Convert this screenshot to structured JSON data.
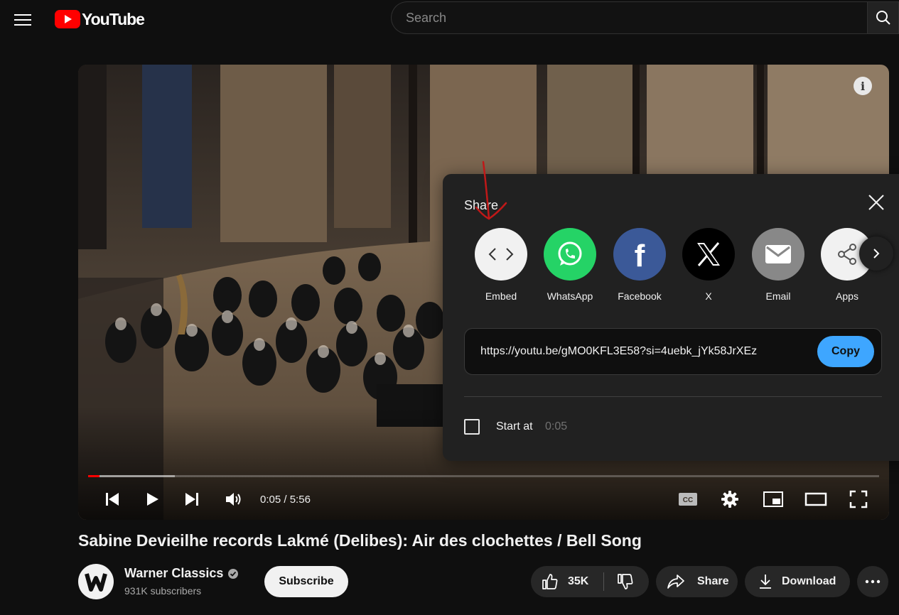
{
  "header": {
    "logo_text": "YouTube",
    "search_placeholder": "Search"
  },
  "player": {
    "time_current": "0:05",
    "time_separator": " / ",
    "time_total": "5:56",
    "progress_played_fraction": 0.0141,
    "progress_buffered_fraction": 0.11
  },
  "share_dialog": {
    "title": "Share",
    "targets": [
      {
        "label": "Embed",
        "icon": "embed-icon",
        "color": "#f1f1f1"
      },
      {
        "label": "WhatsApp",
        "icon": "whatsapp-icon",
        "color": "#25d366"
      },
      {
        "label": "Facebook",
        "icon": "facebook-icon",
        "color": "#3b5998"
      },
      {
        "label": "X",
        "icon": "x-icon",
        "color": "#000000"
      },
      {
        "label": "Email",
        "icon": "email-icon",
        "color": "#888888"
      },
      {
        "label": "Apps",
        "icon": "apps-share-icon",
        "color": "#f1f1f1"
      }
    ],
    "url": "https://youtu.be/gMO0KFL3E58?si=4uebk_jYk58JrXEz",
    "copy_label": "Copy",
    "start_at_label": "Start at",
    "start_at_time": "0:05",
    "start_at_checked": false
  },
  "video": {
    "title": "Sabine Devieilhe records Lakmé (Delibes): Air des clochettes / Bell Song",
    "channel_name": "Warner Classics",
    "subscribers": "931K subscribers",
    "subscribe_label": "Subscribe",
    "likes": "35K",
    "share_label": "Share",
    "download_label": "Download"
  },
  "colors": {
    "accent_blue": "#3ea6ff",
    "youtube_red": "#ff0000",
    "background": "#0f0f0f"
  }
}
